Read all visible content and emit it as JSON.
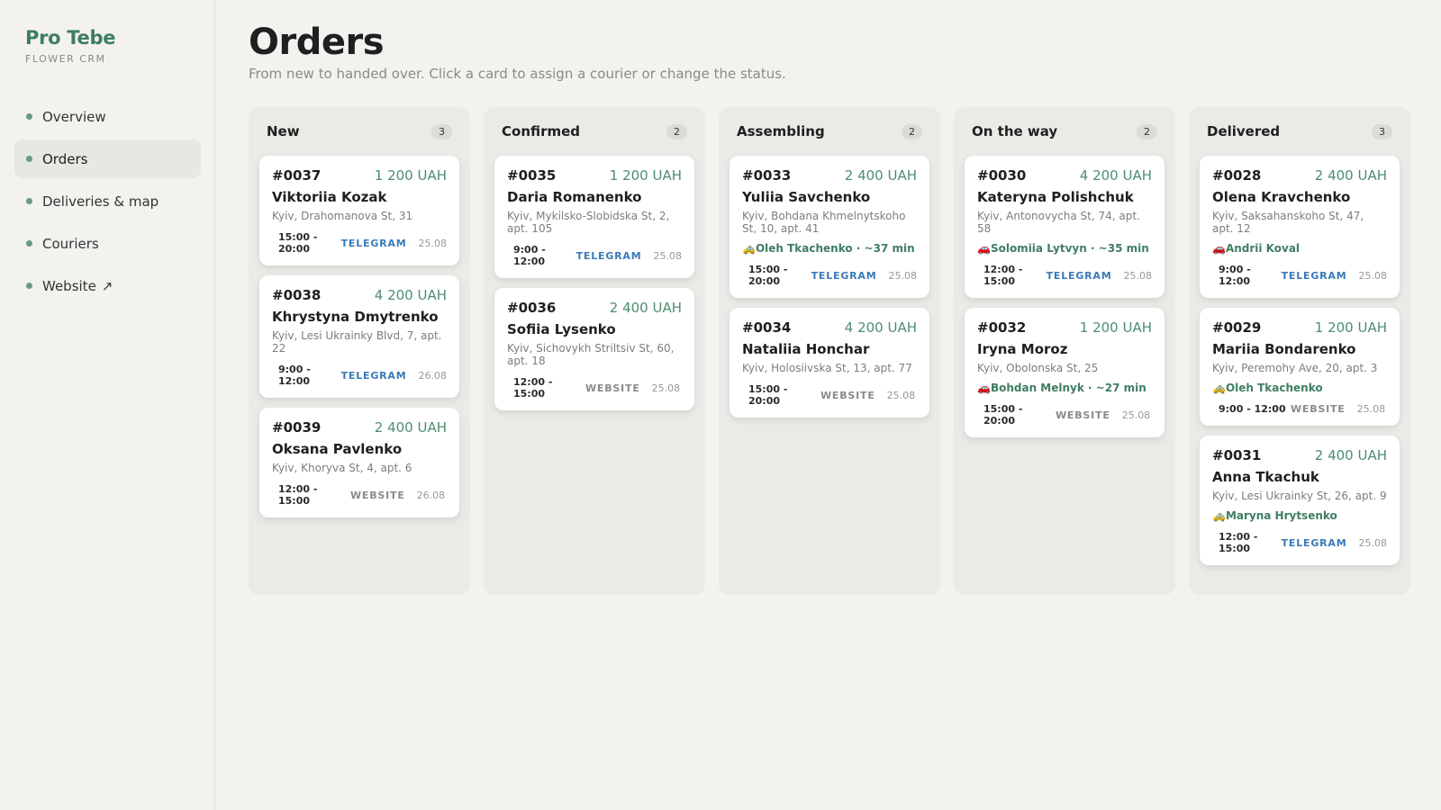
{
  "brand": {
    "name": "Pro Tebe",
    "subtitle": "FLOWER CRM"
  },
  "nav": [
    {
      "label": "Overview",
      "active": false
    },
    {
      "label": "Orders",
      "active": true
    },
    {
      "label": "Deliveries & map",
      "active": false
    },
    {
      "label": "Couriers",
      "active": false
    },
    {
      "label": "Website",
      "active": false,
      "external": "↗"
    }
  ],
  "page": {
    "title": "Orders",
    "subtitle": "From new to handed over. Click a card to assign a courier or change the status."
  },
  "columns": [
    {
      "title": "New",
      "count": "3",
      "cards": [
        {
          "id": "#0037",
          "amount": "1 200 UAH",
          "name": "Viktoriia Kozak",
          "address": "Kyiv, Drahomanova St, 31",
          "courier": "",
          "time": "15:00 - 20:00",
          "source": "TELEGRAM",
          "date": "25.08"
        },
        {
          "id": "#0038",
          "amount": "4 200 UAH",
          "name": "Khrystyna Dmytrenko",
          "address": "Kyiv, Lesi Ukrainky Blvd, 7, apt. 22",
          "courier": "",
          "time": "9:00 - 12:00",
          "source": "TELEGRAM",
          "date": "26.08"
        },
        {
          "id": "#0039",
          "amount": "2 400 UAH",
          "name": "Oksana Pavlenko",
          "address": "Kyiv, Khoryva St, 4, apt. 6",
          "courier": "",
          "time": "12:00 - 15:00",
          "source": "WEBSITE",
          "date": "26.08"
        }
      ]
    },
    {
      "title": "Confirmed",
      "count": "2",
      "cards": [
        {
          "id": "#0035",
          "amount": "1 200 UAH",
          "name": "Daria Romanenko",
          "address": "Kyiv, Mykilsko-Slobidska St, 2, apt. 105",
          "courier": "",
          "time": "9:00 - 12:00",
          "source": "TELEGRAM",
          "date": "25.08"
        },
        {
          "id": "#0036",
          "amount": "2 400 UAH",
          "name": "Sofiia Lysenko",
          "address": "Kyiv, Sichovykh Striltsiv St, 60, apt. 18",
          "courier": "",
          "time": "12:00 - 15:00",
          "source": "WEBSITE",
          "date": "25.08"
        }
      ]
    },
    {
      "title": "Assembling",
      "count": "2",
      "cards": [
        {
          "id": "#0033",
          "amount": "2 400 UAH",
          "name": "Yuliia Savchenko",
          "address": "Kyiv, Bohdana Khmelnytskoho St, 10, apt. 41",
          "courier": "🚕Oleh Tkachenko · ~37 min",
          "time": "15:00 - 20:00",
          "source": "TELEGRAM",
          "date": "25.08"
        },
        {
          "id": "#0034",
          "amount": "4 200 UAH",
          "name": "Nataliia Honchar",
          "address": "Kyiv, Holosiivska St, 13, apt. 77",
          "courier": "",
          "time": "15:00 - 20:00",
          "source": "WEBSITE",
          "date": "25.08"
        }
      ]
    },
    {
      "title": "On the way",
      "count": "2",
      "cards": [
        {
          "id": "#0030",
          "amount": "4 200 UAH",
          "name": "Kateryna Polishchuk",
          "address": "Kyiv, Antonovycha St, 74, apt. 58",
          "courier": "🚗Solomiia Lytvyn · ~35 min",
          "time": "12:00 - 15:00",
          "source": "TELEGRAM",
          "date": "25.08"
        },
        {
          "id": "#0032",
          "amount": "1 200 UAH",
          "name": "Iryna Moroz",
          "address": "Kyiv, Obolonska St, 25",
          "courier": "🚗Bohdan Melnyk · ~27 min",
          "time": "15:00 - 20:00",
          "source": "WEBSITE",
          "date": "25.08"
        }
      ]
    },
    {
      "title": "Delivered",
      "count": "3",
      "cards": [
        {
          "id": "#0028",
          "amount": "2 400 UAH",
          "name": "Olena Kravchenko",
          "address": "Kyiv, Saksahanskoho St, 47, apt. 12",
          "courier": "🚗Andrii Koval",
          "time": "9:00 - 12:00",
          "source": "TELEGRAM",
          "date": "25.08"
        },
        {
          "id": "#0029",
          "amount": "1 200 UAH",
          "name": "Mariia Bondarenko",
          "address": "Kyiv, Peremohy Ave, 20, apt. 3",
          "courier": "🚕Oleh Tkachenko",
          "time": "9:00 - 12:00",
          "source": "WEBSITE",
          "date": "25.08"
        },
        {
          "id": "#0031",
          "amount": "2 400 UAH",
          "name": "Anna Tkachuk",
          "address": "Kyiv, Lesi Ukrainky St, 26, apt. 9",
          "courier": "🚕Maryna Hrytsenko",
          "time": "12:00 - 15:00",
          "source": "TELEGRAM",
          "date": "25.08"
        }
      ]
    }
  ]
}
